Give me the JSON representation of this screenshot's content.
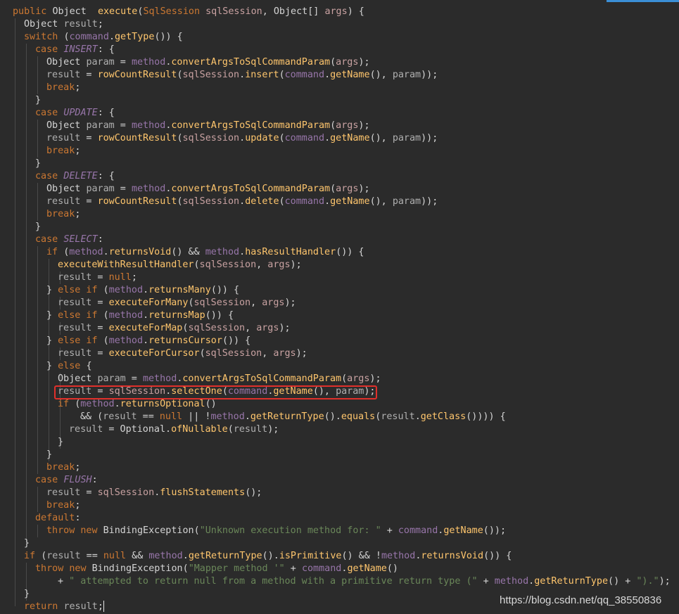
{
  "colors": {
    "background": "#2b2b2b",
    "keyword": "#cc7832",
    "field": "#9876aa",
    "method": "#ffc66d",
    "string": "#6a8759",
    "highlight_box": "#e0302b"
  },
  "code_lines": [
    [
      [
        "kw",
        "public "
      ],
      [
        "ty",
        "Object  "
      ],
      [
        "mth",
        "execute"
      ],
      [
        "ty",
        "("
      ],
      [
        "kw",
        "SqlSession "
      ],
      [
        "prm",
        "sqlSession"
      ],
      [
        "ty",
        ", Object[] "
      ],
      [
        "prm",
        "args"
      ],
      [
        "ty",
        ") {"
      ]
    ],
    [
      [
        "ty",
        "Object "
      ],
      [
        "lv",
        "result"
      ],
      [
        "ty",
        ";"
      ]
    ],
    [
      [
        "kw",
        "switch "
      ],
      [
        "ty",
        "("
      ],
      [
        "fld",
        "command"
      ],
      [
        "ty",
        "."
      ],
      [
        "mth",
        "getType"
      ],
      [
        "ty",
        "()) {"
      ]
    ],
    [
      [
        "kw",
        "case "
      ],
      [
        "cn",
        "INSERT"
      ],
      [
        "ty",
        ": {"
      ]
    ],
    [
      [
        "ty",
        "Object "
      ],
      [
        "lv",
        "param"
      ],
      [
        "ty",
        " = "
      ],
      [
        "fld",
        "method"
      ],
      [
        "ty",
        "."
      ],
      [
        "mth",
        "convertArgsToSqlCommandParam"
      ],
      [
        "ty",
        "("
      ],
      [
        "prm",
        "args"
      ],
      [
        "ty",
        ");"
      ]
    ],
    [
      [
        "lv",
        "result"
      ],
      [
        "ty",
        " = "
      ],
      [
        "mth",
        "rowCountResult"
      ],
      [
        "ty",
        "("
      ],
      [
        "prm",
        "sqlSession"
      ],
      [
        "ty",
        "."
      ],
      [
        "mth",
        "insert"
      ],
      [
        "ty",
        "("
      ],
      [
        "fld",
        "command"
      ],
      [
        "ty",
        "."
      ],
      [
        "mth",
        "getName"
      ],
      [
        "ty",
        "(), "
      ],
      [
        "lv",
        "param"
      ],
      [
        "ty",
        "));"
      ]
    ],
    [
      [
        "kw",
        "break"
      ],
      [
        "ty",
        ";"
      ]
    ],
    [
      [
        "ty",
        "}"
      ]
    ],
    [
      [
        "kw",
        "case "
      ],
      [
        "cn",
        "UPDATE"
      ],
      [
        "ty",
        ": {"
      ]
    ],
    [
      [
        "ty",
        "Object "
      ],
      [
        "lv",
        "param"
      ],
      [
        "ty",
        " = "
      ],
      [
        "fld",
        "method"
      ],
      [
        "ty",
        "."
      ],
      [
        "mth",
        "convertArgsToSqlCommandParam"
      ],
      [
        "ty",
        "("
      ],
      [
        "prm",
        "args"
      ],
      [
        "ty",
        ");"
      ]
    ],
    [
      [
        "lv",
        "result"
      ],
      [
        "ty",
        " = "
      ],
      [
        "mth",
        "rowCountResult"
      ],
      [
        "ty",
        "("
      ],
      [
        "prm",
        "sqlSession"
      ],
      [
        "ty",
        "."
      ],
      [
        "mth",
        "update"
      ],
      [
        "ty",
        "("
      ],
      [
        "fld",
        "command"
      ],
      [
        "ty",
        "."
      ],
      [
        "mth",
        "getName"
      ],
      [
        "ty",
        "(), "
      ],
      [
        "lv",
        "param"
      ],
      [
        "ty",
        "));"
      ]
    ],
    [
      [
        "kw",
        "break"
      ],
      [
        "ty",
        ";"
      ]
    ],
    [
      [
        "ty",
        "}"
      ]
    ],
    [
      [
        "kw",
        "case "
      ],
      [
        "cn",
        "DELETE"
      ],
      [
        "ty",
        ": {"
      ]
    ],
    [
      [
        "ty",
        "Object "
      ],
      [
        "lv",
        "param"
      ],
      [
        "ty",
        " = "
      ],
      [
        "fld",
        "method"
      ],
      [
        "ty",
        "."
      ],
      [
        "mth",
        "convertArgsToSqlCommandParam"
      ],
      [
        "ty",
        "("
      ],
      [
        "prm",
        "args"
      ],
      [
        "ty",
        ");"
      ]
    ],
    [
      [
        "lv",
        "result"
      ],
      [
        "ty",
        " = "
      ],
      [
        "mth",
        "rowCountResult"
      ],
      [
        "ty",
        "("
      ],
      [
        "prm",
        "sqlSession"
      ],
      [
        "ty",
        "."
      ],
      [
        "mth",
        "delete"
      ],
      [
        "ty",
        "("
      ],
      [
        "fld",
        "command"
      ],
      [
        "ty",
        "."
      ],
      [
        "mth",
        "getName"
      ],
      [
        "ty",
        "(), "
      ],
      [
        "lv",
        "param"
      ],
      [
        "ty",
        "));"
      ]
    ],
    [
      [
        "kw",
        "break"
      ],
      [
        "ty",
        ";"
      ]
    ],
    [
      [
        "ty",
        "}"
      ]
    ],
    [
      [
        "kw",
        "case "
      ],
      [
        "cn",
        "SELECT"
      ],
      [
        "ty",
        ":"
      ]
    ],
    [
      [
        "kw",
        "if "
      ],
      [
        "ty",
        "("
      ],
      [
        "fld",
        "method"
      ],
      [
        "ty",
        "."
      ],
      [
        "mth",
        "returnsVoid"
      ],
      [
        "ty",
        "() && "
      ],
      [
        "fld",
        "method"
      ],
      [
        "ty",
        "."
      ],
      [
        "mth",
        "hasResultHandler"
      ],
      [
        "ty",
        "()) {"
      ]
    ],
    [
      [
        "mth",
        "executeWithResultHandler"
      ],
      [
        "ty",
        "("
      ],
      [
        "prm",
        "sqlSession"
      ],
      [
        "ty",
        ", "
      ],
      [
        "prm",
        "args"
      ],
      [
        "ty",
        ");"
      ]
    ],
    [
      [
        "lv",
        "result"
      ],
      [
        "ty",
        " = "
      ],
      [
        "kw",
        "null"
      ],
      [
        "ty",
        ";"
      ]
    ],
    [
      [
        "ty",
        "} "
      ],
      [
        "kw",
        "else if "
      ],
      [
        "ty",
        "("
      ],
      [
        "fld",
        "method"
      ],
      [
        "ty",
        "."
      ],
      [
        "mth",
        "returnsMany"
      ],
      [
        "ty",
        "()) {"
      ]
    ],
    [
      [
        "lv",
        "result"
      ],
      [
        "ty",
        " = "
      ],
      [
        "mth",
        "executeForMany"
      ],
      [
        "ty",
        "("
      ],
      [
        "prm",
        "sqlSession"
      ],
      [
        "ty",
        ", "
      ],
      [
        "prm",
        "args"
      ],
      [
        "ty",
        ");"
      ]
    ],
    [
      [
        "ty",
        "} "
      ],
      [
        "kw",
        "else if "
      ],
      [
        "ty",
        "("
      ],
      [
        "fld",
        "method"
      ],
      [
        "ty",
        "."
      ],
      [
        "mth",
        "returnsMap"
      ],
      [
        "ty",
        "()) {"
      ]
    ],
    [
      [
        "lv",
        "result"
      ],
      [
        "ty",
        " = "
      ],
      [
        "mth",
        "executeForMap"
      ],
      [
        "ty",
        "("
      ],
      [
        "prm",
        "sqlSession"
      ],
      [
        "ty",
        ", "
      ],
      [
        "prm",
        "args"
      ],
      [
        "ty",
        ");"
      ]
    ],
    [
      [
        "ty",
        "} "
      ],
      [
        "kw",
        "else if "
      ],
      [
        "ty",
        "("
      ],
      [
        "fld",
        "method"
      ],
      [
        "ty",
        "."
      ],
      [
        "mth",
        "returnsCursor"
      ],
      [
        "ty",
        "()) {"
      ]
    ],
    [
      [
        "lv",
        "result"
      ],
      [
        "ty",
        " = "
      ],
      [
        "mth",
        "executeForCursor"
      ],
      [
        "ty",
        "("
      ],
      [
        "prm",
        "sqlSession"
      ],
      [
        "ty",
        ", "
      ],
      [
        "prm",
        "args"
      ],
      [
        "ty",
        ");"
      ]
    ],
    [
      [
        "ty",
        "} "
      ],
      [
        "kw",
        "else "
      ],
      [
        "ty",
        "{"
      ]
    ],
    [
      [
        "ty",
        "Object "
      ],
      [
        "lv",
        "param"
      ],
      [
        "ty",
        " = "
      ],
      [
        "fld",
        "method"
      ],
      [
        "ty",
        "."
      ],
      [
        "mth",
        "convertArgsToSqlCommandParam"
      ],
      [
        "ty",
        "("
      ],
      [
        "prm",
        "args"
      ],
      [
        "ty",
        ");"
      ]
    ],
    [
      [
        "lv",
        "result"
      ],
      [
        "ty",
        " = "
      ],
      [
        "prm",
        "sqlSession"
      ],
      [
        "ty",
        "."
      ],
      [
        "mth",
        "selectOne"
      ],
      [
        "ty",
        "("
      ],
      [
        "fld",
        "command"
      ],
      [
        "ty",
        "."
      ],
      [
        "mth",
        "getName"
      ],
      [
        "ty",
        "(), "
      ],
      [
        "lv",
        "param"
      ],
      [
        "ty",
        ");"
      ]
    ],
    [
      [
        "kw",
        "if "
      ],
      [
        "ty",
        "("
      ],
      [
        "fld",
        "method"
      ],
      [
        "ty",
        "."
      ],
      [
        "mth",
        "returnsOptional"
      ],
      [
        "ty",
        "()"
      ]
    ],
    [
      [
        "ty",
        "&& ("
      ],
      [
        "lv",
        "result"
      ],
      [
        "ty",
        " == "
      ],
      [
        "kw",
        "null"
      ],
      [
        "ty",
        " || !"
      ],
      [
        "fld",
        "method"
      ],
      [
        "ty",
        "."
      ],
      [
        "mth",
        "getReturnType"
      ],
      [
        "ty",
        "()."
      ],
      [
        "mth",
        "equals"
      ],
      [
        "ty",
        "("
      ],
      [
        "lv",
        "result"
      ],
      [
        "ty",
        "."
      ],
      [
        "mth",
        "getClass"
      ],
      [
        "ty",
        "()))) {"
      ]
    ],
    [
      [
        "lv",
        "result"
      ],
      [
        "ty",
        " = Optional."
      ],
      [
        "mth",
        "ofNullable"
      ],
      [
        "ty",
        "("
      ],
      [
        "lv",
        "result"
      ],
      [
        "ty",
        ");"
      ]
    ],
    [
      [
        "ty",
        "}"
      ]
    ],
    [
      [
        "ty",
        "}"
      ]
    ],
    [
      [
        "kw",
        "break"
      ],
      [
        "ty",
        ";"
      ]
    ],
    [
      [
        "kw",
        "case "
      ],
      [
        "cn",
        "FLUSH"
      ],
      [
        "ty",
        ":"
      ]
    ],
    [
      [
        "lv",
        "result"
      ],
      [
        "ty",
        " = "
      ],
      [
        "prm",
        "sqlSession"
      ],
      [
        "ty",
        "."
      ],
      [
        "mth",
        "flushStatements"
      ],
      [
        "ty",
        "();"
      ]
    ],
    [
      [
        "kw",
        "break"
      ],
      [
        "ty",
        ";"
      ]
    ],
    [
      [
        "kw",
        "default"
      ],
      [
        "ty",
        ":"
      ]
    ],
    [
      [
        "kw",
        "throw new "
      ],
      [
        "ty",
        "BindingException("
      ],
      [
        "str",
        "\"Unknown execution method for: \""
      ],
      [
        "ty",
        " + "
      ],
      [
        "fld",
        "command"
      ],
      [
        "ty",
        "."
      ],
      [
        "mth",
        "getName"
      ],
      [
        "ty",
        "());"
      ]
    ],
    [
      [
        "ty",
        "}"
      ]
    ],
    [
      [
        "kw",
        "if "
      ],
      [
        "ty",
        "("
      ],
      [
        "lv",
        "result"
      ],
      [
        "ty",
        " == "
      ],
      [
        "kw",
        "null"
      ],
      [
        "ty",
        " && "
      ],
      [
        "fld",
        "method"
      ],
      [
        "ty",
        "."
      ],
      [
        "mth",
        "getReturnType"
      ],
      [
        "ty",
        "()."
      ],
      [
        "mth",
        "isPrimitive"
      ],
      [
        "ty",
        "() && !"
      ],
      [
        "fld",
        "method"
      ],
      [
        "ty",
        "."
      ],
      [
        "mth",
        "returnsVoid"
      ],
      [
        "ty",
        "()) {"
      ]
    ],
    [
      [
        "kw",
        "throw new "
      ],
      [
        "ty",
        "BindingException("
      ],
      [
        "str",
        "\"Mapper method '\""
      ],
      [
        "ty",
        " + "
      ],
      [
        "fld",
        "command"
      ],
      [
        "ty",
        "."
      ],
      [
        "mth",
        "getName"
      ],
      [
        "ty",
        "()"
      ]
    ],
    [
      [
        "ty",
        "+ "
      ],
      [
        "str",
        "\" attempted to return null from a method with a primitive return type (\""
      ],
      [
        "ty",
        " + "
      ],
      [
        "fld",
        "method"
      ],
      [
        "ty",
        "."
      ],
      [
        "mth",
        "getReturnType"
      ],
      [
        "ty",
        "() + "
      ],
      [
        "str",
        "\").\""
      ],
      [
        "ty",
        ");"
      ]
    ],
    [
      [
        "ty",
        "}"
      ]
    ],
    [
      [
        "kw",
        "return "
      ],
      [
        "lv",
        "result"
      ],
      [
        "ty",
        ";"
      ]
    ]
  ],
  "watermark": "https://blog.csdn.net/qq_38550836"
}
